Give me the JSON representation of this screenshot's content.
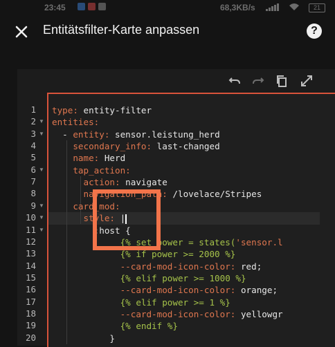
{
  "status_bar": {
    "time": "23:45",
    "net_speed": "68,3KB/s",
    "battery": "21"
  },
  "header": {
    "title": "Entitätsfilter-Karte anpassen",
    "help": "?"
  },
  "toolbar": {
    "icons": [
      "undo-icon",
      "redo-icon",
      "copy-icon",
      "fullscreen-icon"
    ]
  },
  "editor": {
    "line_numbers": [
      "1",
      "2",
      "3",
      "4",
      "5",
      "6",
      "7",
      "8",
      "9",
      "10",
      "11",
      "12",
      "13",
      "14",
      "15",
      "16",
      "17",
      "18",
      "19",
      "20"
    ],
    "lines": [
      [
        {
          "t": "type: ",
          "c": "k"
        },
        {
          "t": "entity-filter",
          "c": "v"
        }
      ],
      [
        {
          "t": "entities:",
          "c": "k"
        }
      ],
      [
        {
          "t": "  - ",
          "c": "v"
        },
        {
          "t": "entity: ",
          "c": "k"
        },
        {
          "t": "sensor.leistung_herd",
          "c": "v"
        }
      ],
      [
        {
          "t": "    ",
          "c": "v"
        },
        {
          "t": "secondary_info: ",
          "c": "k"
        },
        {
          "t": "last-changed",
          "c": "v"
        }
      ],
      [
        {
          "t": "    ",
          "c": "v"
        },
        {
          "t": "name: ",
          "c": "k"
        },
        {
          "t": "Herd",
          "c": "v"
        }
      ],
      [
        {
          "t": "    ",
          "c": "v"
        },
        {
          "t": "tap_action:",
          "c": "k"
        }
      ],
      [
        {
          "t": "      ",
          "c": "v"
        },
        {
          "t": "action: ",
          "c": "k"
        },
        {
          "t": "navigate",
          "c": "v"
        }
      ],
      [
        {
          "t": "      ",
          "c": "v"
        },
        {
          "t": "navigation_path: ",
          "c": "k"
        },
        {
          "t": "/lovelace/Stripes",
          "c": "v"
        }
      ],
      [
        {
          "t": "    ",
          "c": "v"
        },
        {
          "t": "card_mod:",
          "c": "k"
        }
      ],
      [
        {
          "t": "      ",
          "c": "v"
        },
        {
          "t": "style: ",
          "c": "k"
        },
        {
          "t": "|",
          "c": "v"
        }
      ],
      [
        {
          "t": "        :host {",
          "c": "v"
        }
      ],
      [
        {
          "t": "             {% set power = states(",
          "c": "s"
        },
        {
          "t": "'sensor.l",
          "c": "k"
        }
      ],
      [
        {
          "t": "             {% if power >= 2000 %}",
          "c": "s"
        }
      ],
      [
        {
          "t": "             --card-mod-icon-color: ",
          "c": "k"
        },
        {
          "t": "red;",
          "c": "v"
        }
      ],
      [
        {
          "t": "             {% elif power >= 1000 %}",
          "c": "s"
        }
      ],
      [
        {
          "t": "             --card-mod-icon-color: ",
          "c": "k"
        },
        {
          "t": "orange;",
          "c": "v"
        }
      ],
      [
        {
          "t": "             {% elif power >= 1 %}",
          "c": "s"
        }
      ],
      [
        {
          "t": "             --card-mod-icon-color: ",
          "c": "k"
        },
        {
          "t": "yellowgr",
          "c": "v"
        }
      ],
      [
        {
          "t": "             {% endif %}",
          "c": "s"
        }
      ],
      [
        {
          "t": "           }",
          "c": "v"
        }
      ]
    ],
    "fold_lines": [
      2,
      3,
      6,
      9,
      10,
      11
    ]
  }
}
